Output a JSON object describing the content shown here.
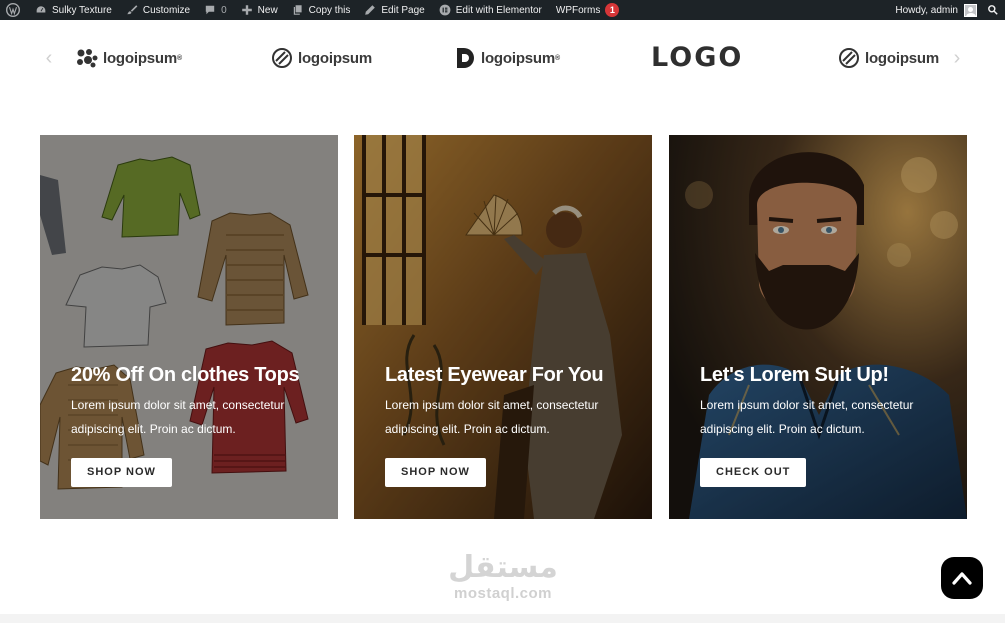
{
  "adminbar": {
    "items": [
      {
        "label": "",
        "icon": "wordpress-icon"
      },
      {
        "label": "Sulky Texture",
        "icon": "dashboard-icon"
      },
      {
        "label": "Customize",
        "icon": "brush-icon"
      },
      {
        "label": "0",
        "icon": "comment-icon"
      },
      {
        "label": "New",
        "icon": "plus-icon"
      },
      {
        "label": "Copy this",
        "icon": "copy-icon"
      },
      {
        "label": "Edit Page",
        "icon": "pencil-icon"
      },
      {
        "label": "Edit with Elementor",
        "icon": "elementor-icon"
      },
      {
        "label": "WPForms",
        "icon": ""
      }
    ],
    "wpforms_count": "1",
    "howdy": "Howdy, admin"
  },
  "logos": {
    "items": [
      "logoipsum",
      "logoipsum",
      "logoipsum",
      "LOGO",
      "logoipsum"
    ],
    "prev_arrow": "‹",
    "next_arrow": "›"
  },
  "cards": [
    {
      "title": "20% Off On clothes Tops",
      "text": "Lorem ipsum dolor sit amet, consectetur adipiscing elit. Proin ac dictum.",
      "button": "SHOP NOW"
    },
    {
      "title": "Latest Eyewear For You",
      "text": "Lorem ipsum dolor sit amet, consectetur adipiscing elit. Proin ac dictum.",
      "button": "SHOP NOW"
    },
    {
      "title": "Let's Lorem Suit Up!",
      "text": "Lorem ipsum dolor sit amet, consectetur adipiscing elit. Proin ac dictum.",
      "button": "CHECK OUT"
    }
  ],
  "watermark": {
    "arabic": "مستقل",
    "latin": "mostaql.com"
  },
  "colors": {
    "adminbar_bg": "#1d2327",
    "badge": "#d63638",
    "button_bg": "#ffffff",
    "to_top_bg": "#000000"
  }
}
